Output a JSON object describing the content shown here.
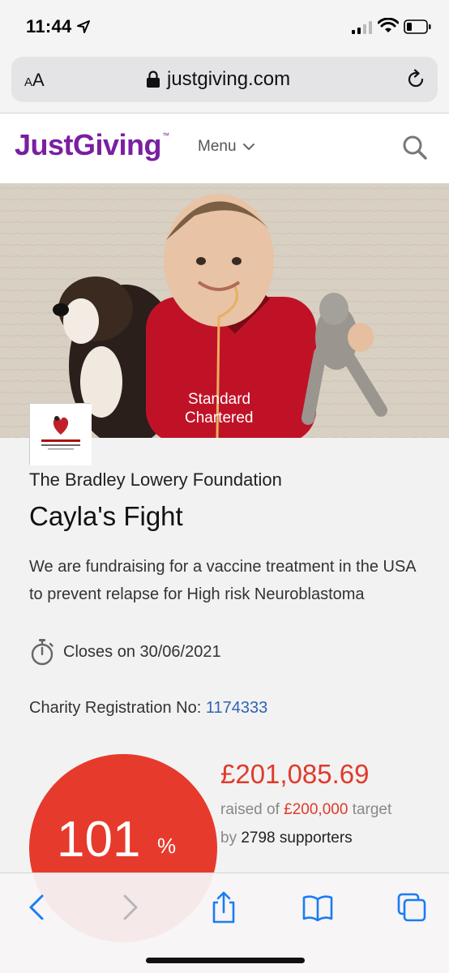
{
  "status_bar": {
    "time": "11:44"
  },
  "browser": {
    "aa_label_small": "A",
    "aa_label_large": "A",
    "url": "justgiving.com"
  },
  "header": {
    "logo_text": "JustGiving",
    "logo_tm": "™",
    "menu_label": "Menu"
  },
  "page": {
    "charity_name": "The Bradley Lowery Foundation",
    "title": "Cayla's Fight",
    "summary": "We are fundraising for a vaccine treatment in the USA to prevent relapse for High risk Neuroblastoma",
    "closes_text": "Closes on 30/06/2021",
    "charity_reg_label": "Charity Registration No: ",
    "charity_reg_number": "1174333"
  },
  "progress": {
    "percent": "101",
    "percent_sign": "%",
    "raised_amount": "£201,085.69",
    "raised_prefix": "raised of ",
    "target": "£200,000",
    "target_suffix": " target",
    "by_prefix": "by ",
    "supporters_count": "2798",
    "supporters_suffix": " supporters"
  },
  "icons": {
    "location": "location-arrow-icon",
    "signal": "cellular-signal-icon",
    "wifi": "wifi-icon",
    "battery": "battery-icon",
    "lock": "lock-icon",
    "reload": "reload-icon",
    "chevron": "chevron-down-icon",
    "search": "search-icon",
    "stopwatch": "stopwatch-icon",
    "back": "back-icon",
    "forward": "forward-icon",
    "share": "share-icon",
    "bookmarks": "bookmarks-icon",
    "tabs": "tabs-icon"
  },
  "colors": {
    "brand_purple": "#7a1fa2",
    "accent_red": "#e63a2c",
    "link_blue": "#2f63b5",
    "ios_blue": "#1a7cf5"
  }
}
